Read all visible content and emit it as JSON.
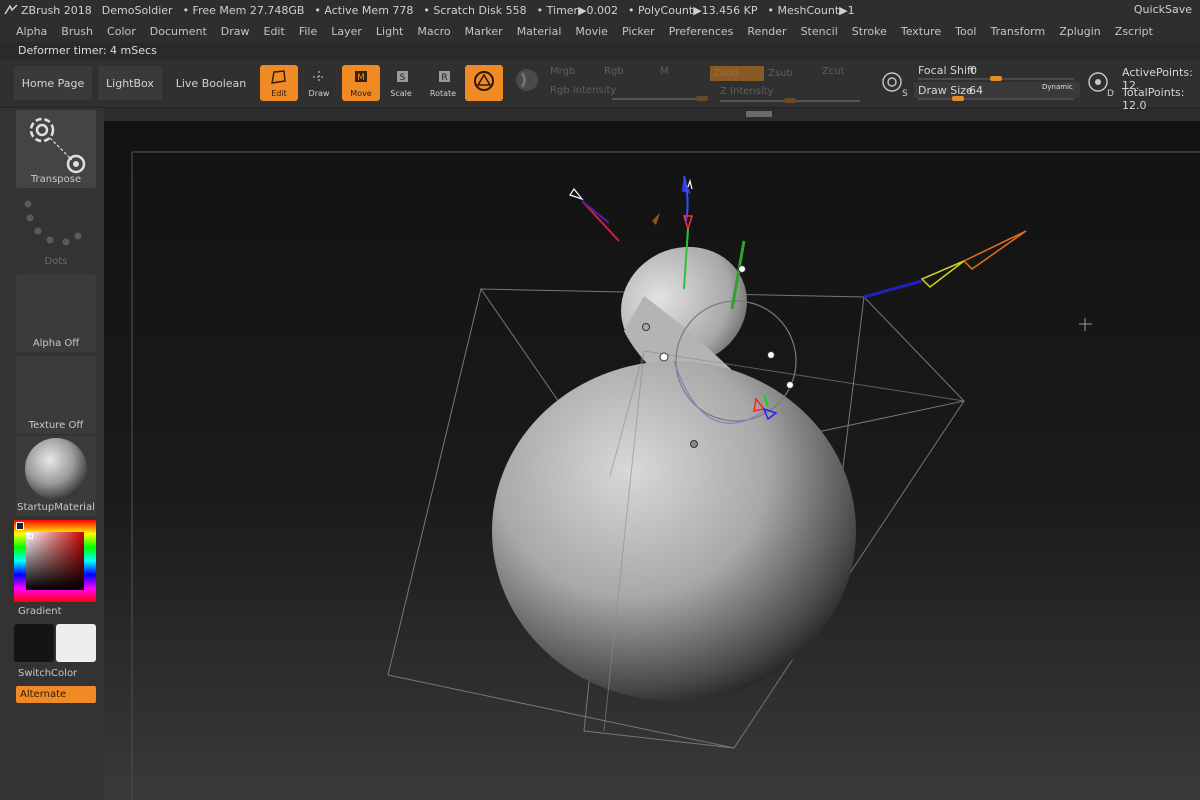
{
  "titlebar": {
    "app": "ZBrush 2018",
    "doc": "DemoSoldier",
    "free_mem": "• Free Mem 27.748GB",
    "active_mem": "• Active Mem 778",
    "scratch": "• Scratch Disk 558",
    "timer": "• Timer▶0.002",
    "polycount": "• PolyCount▶13.456 KP",
    "meshcount": "• MeshCount▶1",
    "quicksave": "QuickSave"
  },
  "menu": [
    "Alpha",
    "Brush",
    "Color",
    "Document",
    "Draw",
    "Edit",
    "File",
    "Layer",
    "Light",
    "Macro",
    "Marker",
    "Material",
    "Movie",
    "Picker",
    "Preferences",
    "Render",
    "Stencil",
    "Stroke",
    "Texture",
    "Tool",
    "Transform",
    "Zplugin",
    "Zscript"
  ],
  "status": "Deformer timer: 4 mSecs",
  "shelf": {
    "home": "Home Page",
    "lightbox": "LightBox",
    "liveboolean": "Live Boolean",
    "edit": "Edit",
    "draw": "Draw",
    "move": "Move",
    "scale": "Scale",
    "rotate": "Rotate",
    "mrgb": "Mrgb",
    "rgb": "Rgb",
    "m": "M",
    "rgb_intensity": "Rgb Intensity",
    "zadd": "Zadd",
    "zsub": "Zsub",
    "zcut": "Zcut",
    "z_intensity": "Z Intensity",
    "focal_shift_label": "Focal Shift",
    "focal_shift_value": "0",
    "draw_size_label": "Draw Size",
    "draw_size_value": "64",
    "dynamic": "Dynamic",
    "active_points": "ActivePoints: 12.",
    "total_points": "TotalPoints: 12.0"
  },
  "left": {
    "transpose": "Transpose",
    "dots": "Dots",
    "alpha_off": "Alpha Off",
    "texture_off": "Texture Off",
    "material": "StartupMaterial",
    "gradient": "Gradient",
    "switchcolor": "SwitchColor",
    "alternate": "Alternate"
  },
  "colors": {
    "accent": "#f08a24",
    "panel": "#333333"
  }
}
